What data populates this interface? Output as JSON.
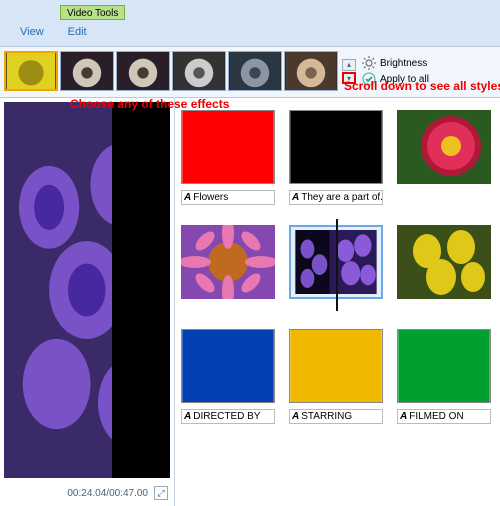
{
  "header": {
    "video_tools": "Video Tools"
  },
  "tabs": {
    "view": "View",
    "edit": "Edit"
  },
  "toolbar": {
    "brightness": "Brightness",
    "apply_all": "Apply to all"
  },
  "annotations": {
    "choose_effects": "Choose any of these effects",
    "scroll_styles": "Scroll down to see all styles"
  },
  "preview": {
    "time_display": "00:24.04/00:47.00"
  },
  "gallery": {
    "row1_labels": {
      "l1": "Flowers",
      "l2": "They are a part of..."
    },
    "row3_labels": {
      "l1": "DIRECTED BY",
      "l2": "STARRING",
      "l3": "FILMED ON"
    },
    "a_prefix": "A"
  }
}
